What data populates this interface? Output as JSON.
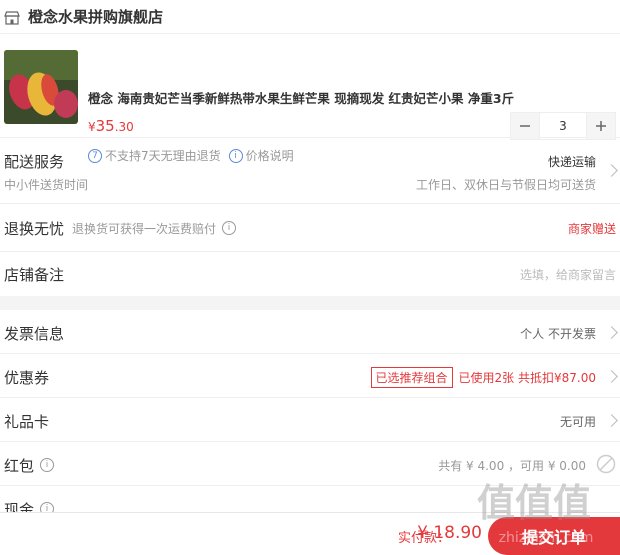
{
  "shop": {
    "name": "橙念水果拼购旗舰店",
    "icon": "store-icon"
  },
  "product": {
    "title": "橙念 海南贵妃芒当季新鲜热带水果生鲜芒果 现摘现发 红贵妃芒小果 净重3斤",
    "price_currency": "¥",
    "price_int": "35",
    "price_dec": ".30",
    "quantity": "3",
    "no_return_text": "不支持7天无理由退货",
    "price_explain_text": "价格说明"
  },
  "delivery": {
    "label": "配送服务",
    "sub": "中小件送货时间",
    "method": "快递运输",
    "time": "工作日、双休日与节假日均可送货"
  },
  "exchange": {
    "label": "退换无忧",
    "sub": "退换货可获得一次运费赔付",
    "value": "商家赠送"
  },
  "remark": {
    "label": "店铺备注",
    "placeholder": "选填，给商家留言"
  },
  "invoice": {
    "label": "发票信息",
    "value": "个人 不开发票"
  },
  "coupon": {
    "label": "优惠券",
    "tag": "已选推荐组合",
    "value": "已使用2张 共抵扣¥87.00"
  },
  "giftcard": {
    "label": "礼品卡",
    "value": "无可用"
  },
  "redpacket": {
    "label": "红包",
    "value": "共有 ¥ 4.00 ，可用 ¥ 0.00"
  },
  "cash": {
    "label": "现金"
  },
  "footer": {
    "total_label": "实付款：",
    "total_currency": "¥ ",
    "total_amount": "18.90",
    "submit_label": "提交订单"
  },
  "watermark": {
    "text": "值值值",
    "site": "zhizhizhi.com"
  },
  "colors": {
    "accent": "#e4393c",
    "link_blue": "#5a8ad6"
  }
}
